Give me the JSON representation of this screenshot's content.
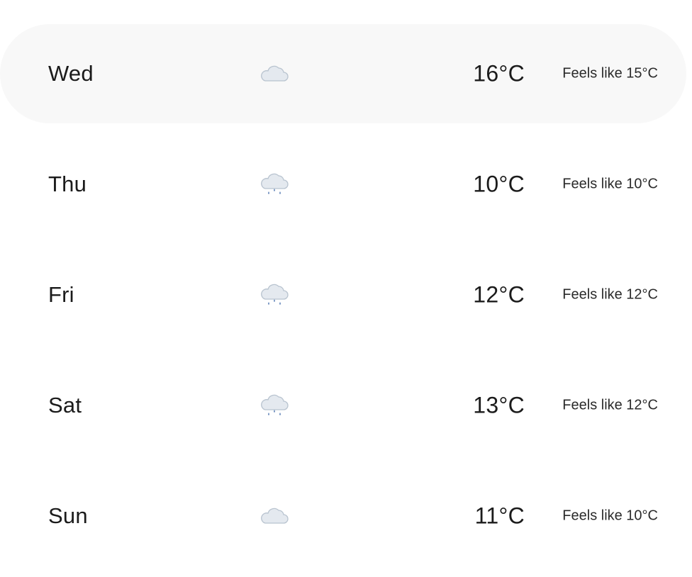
{
  "forecast": {
    "selected_index": 0,
    "days": [
      {
        "day": "Wed",
        "icon": "cloud-icon",
        "temp": "16°C",
        "feels_like": "Feels like 15°C"
      },
      {
        "day": "Thu",
        "icon": "cloud-rain-icon",
        "temp": "10°C",
        "feels_like": "Feels like 10°C"
      },
      {
        "day": "Fri",
        "icon": "cloud-rain-icon",
        "temp": "12°C",
        "feels_like": "Feels like 12°C"
      },
      {
        "day": "Sat",
        "icon": "cloud-rain-icon",
        "temp": "13°C",
        "feels_like": "Feels like 12°C"
      },
      {
        "day": "Sun",
        "icon": "cloud-icon",
        "temp": "11°C",
        "feels_like": "Feels like 10°C"
      }
    ]
  },
  "colors": {
    "selected_row_bg": "#f8f8f8",
    "cloud_fill": "#e4e9ef",
    "cloud_stroke": "#b8c3cf",
    "rain_drop": "#6f8fbf"
  }
}
